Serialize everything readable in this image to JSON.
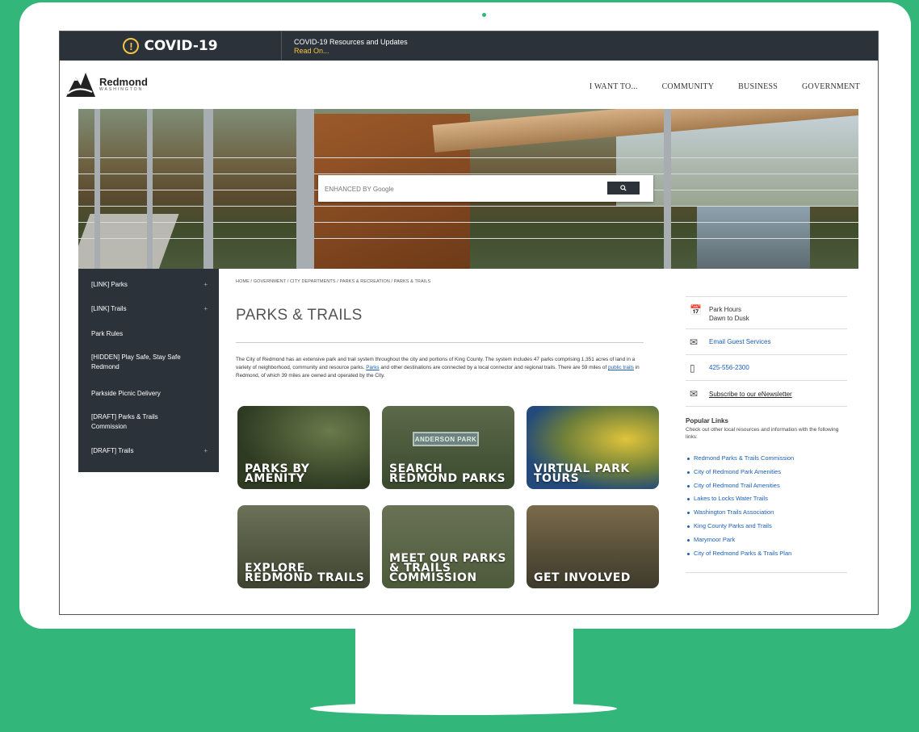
{
  "covid": {
    "title": "COVID-19",
    "alert_icon": "exclamation-circle-icon",
    "headline": "COVID-19 Resources and Updates",
    "readon": "Read On..."
  },
  "header": {
    "logo_name": "Redmond",
    "logo_sub": "WASHINGTON",
    "nav": [
      "I WANT TO...",
      "COMMUNITY",
      "BUSINESS",
      "GOVERNMENT"
    ]
  },
  "search": {
    "placeholder": "ENHANCED BY Google",
    "button_icon": "search-icon"
  },
  "sidebar": {
    "items": [
      {
        "label": "[LINK] Parks",
        "expand": "+"
      },
      {
        "label": "[LINK] Trails",
        "expand": "+"
      },
      {
        "label": "Park Rules",
        "expand": ""
      },
      {
        "label": "[HIDDEN] Play Safe, Stay Safe Redmond",
        "expand": ""
      },
      {
        "label": "Parkside Picnic Delivery",
        "expand": ""
      },
      {
        "label": "[DRAFT] Parks & Trails Commission",
        "expand": ""
      },
      {
        "label": "[DRAFT] Trails",
        "expand": "+"
      }
    ]
  },
  "main": {
    "breadcrumb": "HOME / GOVERNMENT / CITY DEPARTMENTS / PARKS & RECREATION / PARKS & TRAILS",
    "title": "PARKS & TRAILS",
    "intro_a": "The City of Redmond has an extensive park and trail system throughout the city and portions of King County. The system includes 47 parks comprising 1,351 acres of land in a variety of neighborhood, community and resource parks. ",
    "intro_link1": "Parks",
    "intro_b": " and other destinations are connected by a local connector and regional trails. There are 59 miles of ",
    "intro_link2": "public trails",
    "intro_c": " in Redmond, of which 39 miles are owned and operated by the City.",
    "tiles": [
      {
        "label": "PARKS BY AMENITY"
      },
      {
        "label": "SEARCH REDMOND PARKS",
        "sign": "ANDERSON PARK"
      },
      {
        "label": "VIRTUAL PARK TOURS"
      },
      {
        "label": "EXPLORE REDMOND TRAILS"
      },
      {
        "label": "MEET OUR PARKS & TRAILS COMMISSION"
      },
      {
        "label": "GET INVOLVED"
      }
    ]
  },
  "right": {
    "hours_title": "Park Hours",
    "hours_value": "Dawn to Dusk",
    "email": "Email Guest Services",
    "phone": "425-556-2300",
    "subscribe": "Subscribe to our eNewsletter",
    "popular_title": "Popular Links",
    "popular_desc": "Check out other local resources and information with the following links:",
    "links": [
      "Redmond Parks & Trails Commission",
      "City of Redmond Park Amenities",
      "City of Redmond Trail Amenities",
      "Lakes to Locks Water Trails",
      "Washington Trails Association",
      "King County Parks and Trails",
      "Marymoor Park",
      "City of Redmond Parks & Trails Plan"
    ]
  }
}
